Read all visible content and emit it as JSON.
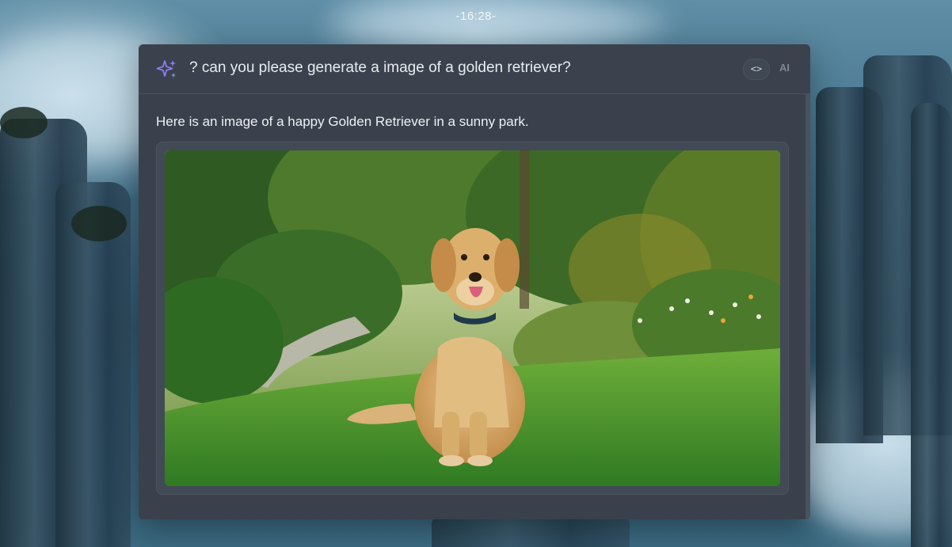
{
  "clock": {
    "time": "-16:28-"
  },
  "chat": {
    "prompt": "? can you please generate a image of a golden retriever?",
    "header_icon": "sparkle-icon",
    "code_button_label": "<>",
    "badge_label": "AI",
    "response": "Here is an image of a happy Golden Retriever in a sunny park.",
    "image_subject": "golden-retriever-in-park"
  },
  "colors": {
    "window_bg": "#3a414c",
    "accent_sparkle": "#8b7cf6",
    "text_primary": "#e8ecf0"
  }
}
